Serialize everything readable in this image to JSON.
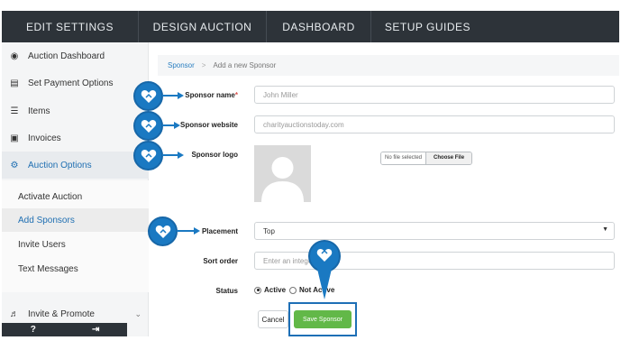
{
  "topnav": {
    "tabs": [
      "EDIT SETTINGS",
      "DESIGN AUCTION",
      "DASHBOARD",
      "SETUP GUIDES"
    ]
  },
  "sidebar": {
    "items": [
      {
        "label": "Auction Dashboard",
        "icon": "palette-icon"
      },
      {
        "label": "Set Payment Options",
        "icon": "money-icon"
      },
      {
        "label": "Items",
        "icon": "list-icon"
      },
      {
        "label": "Invoices",
        "icon": "document-icon"
      },
      {
        "label": "Auction Options",
        "icon": "sitemap-icon"
      }
    ],
    "subitems": [
      "Activate Auction",
      "Add Sponsors",
      "Invite Users",
      "Text Messages"
    ],
    "invite_promote": "Invite & Promote",
    "bottom": {
      "help": "?",
      "logout": "⇥"
    }
  },
  "breadcrumb": {
    "root": "Sponsor",
    "separator": ">",
    "current": "Add a new Sponsor"
  },
  "form": {
    "sponsor_name_label": "Sponsor name",
    "required_mark": "*",
    "sponsor_name_placeholder": "John Miller",
    "sponsor_website_label": "Sponsor website",
    "sponsor_website_placeholder": "charityauctionstoday.com",
    "sponsor_logo_label": "Sponsor logo",
    "file_status": "No file selected",
    "choose_file": "Choose File",
    "placement_label": "Placement",
    "placement_value": "Top",
    "sort_order_label": "Sort order",
    "sort_order_placeholder": "Enter an integer",
    "status_label": "Status",
    "status_active": "Active",
    "status_not_active": "Not Active",
    "status_selected": "Active",
    "cancel": "Cancel",
    "save": "Save Sponsor"
  },
  "colors": {
    "nav_bg": "#2d3339",
    "accent_blue": "#1a79c2",
    "link_blue": "#2a7fc1",
    "save_green": "#62b848"
  }
}
